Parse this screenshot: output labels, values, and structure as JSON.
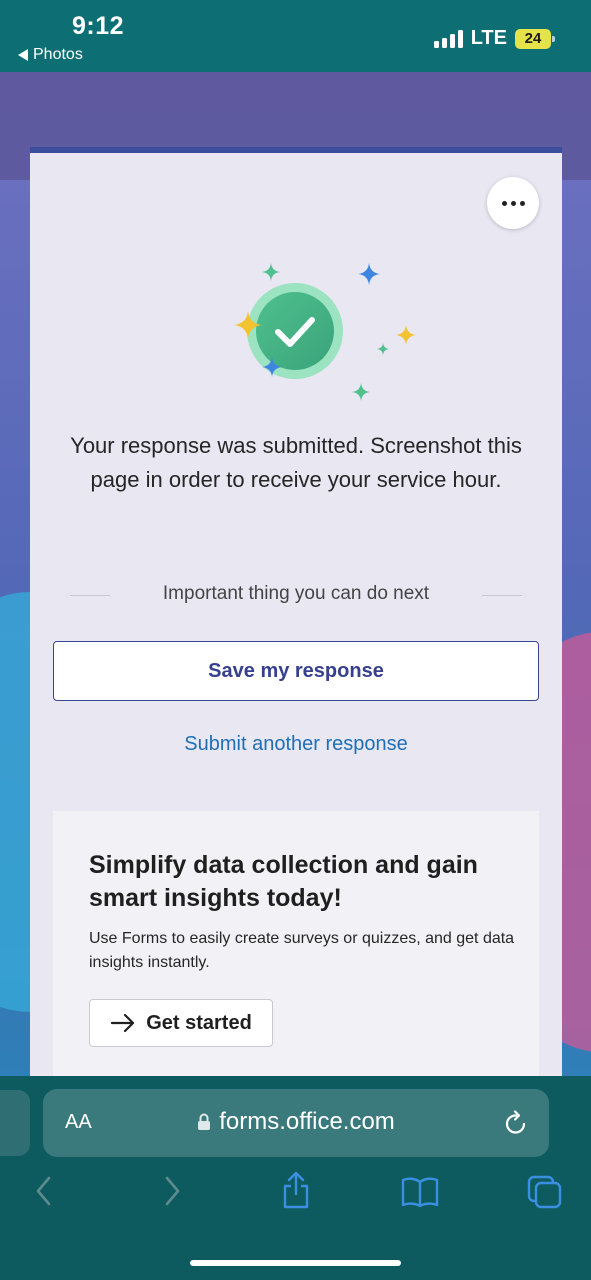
{
  "status_bar": {
    "time": "9:12",
    "back_app": "Photos",
    "network": "LTE",
    "battery": "24"
  },
  "card": {
    "message": "Your response was submitted. Screenshot this page in order to receive your service hour.",
    "next_heading": "Important thing you can do next",
    "save_label": "Save my response",
    "submit_another_label": "Submit another response",
    "promo": {
      "title": "Simplify data collection and gain smart insights today!",
      "description": "Use Forms to easily create surveys or quizzes, and get data insights instantly.",
      "cta_label": "Get started"
    },
    "colors": {
      "accent": "#3a4591",
      "link": "#1f6fb5",
      "success": "#3aa37a"
    }
  },
  "browser": {
    "text_size_button": "AA",
    "url": "forms.office.com"
  },
  "icons": [
    "more-icon",
    "checkmark-icon",
    "sparkle-icon",
    "arrow-right-icon",
    "lock-icon",
    "reload-icon",
    "back-icon",
    "forward-icon",
    "share-icon",
    "bookmarks-icon",
    "tabs-icon"
  ]
}
